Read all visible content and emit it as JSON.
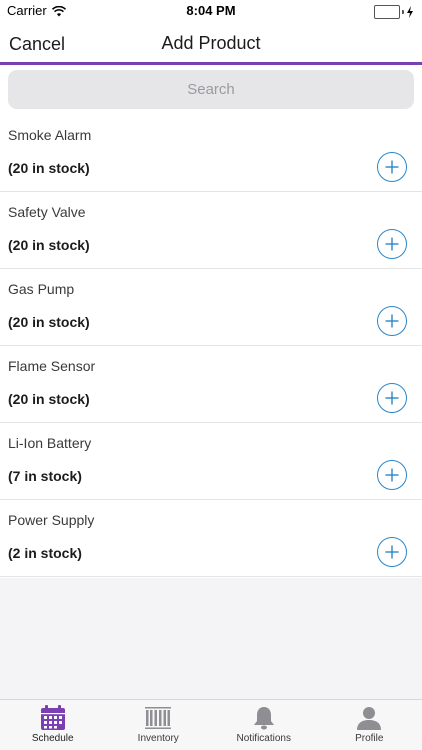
{
  "status_bar": {
    "carrier": "Carrier",
    "time": "8:04 PM",
    "battery_color": "#4cd964"
  },
  "nav": {
    "cancel_label": "Cancel",
    "title": "Add Product",
    "accent_color": "#7a3fb0"
  },
  "search": {
    "placeholder": "Search",
    "value": ""
  },
  "products": [
    {
      "name": "Smoke Alarm",
      "stock": "(20 in stock)"
    },
    {
      "name": "Safety Valve",
      "stock": "(20 in stock)"
    },
    {
      "name": "Gas Pump",
      "stock": "(20 in stock)"
    },
    {
      "name": "Flame Sensor",
      "stock": "(20 in stock)"
    },
    {
      "name": "Li-Ion Battery",
      "stock": "(7 in stock)"
    },
    {
      "name": "Power Supply",
      "stock": "(2 in stock)"
    }
  ],
  "add_icon": "plus-circle-icon",
  "add_color": "#2a86c8",
  "tabs": [
    {
      "label": "Schedule",
      "icon": "calendar-icon",
      "active": true,
      "color": "#7a3fb0"
    },
    {
      "label": "Inventory",
      "icon": "barcode-icon",
      "active": false,
      "color": "#8e8e93"
    },
    {
      "label": "Notifications",
      "icon": "bell-icon",
      "active": false,
      "color": "#8e8e93"
    },
    {
      "label": "Profile",
      "icon": "person-icon",
      "active": false,
      "color": "#8e8e93"
    }
  ]
}
